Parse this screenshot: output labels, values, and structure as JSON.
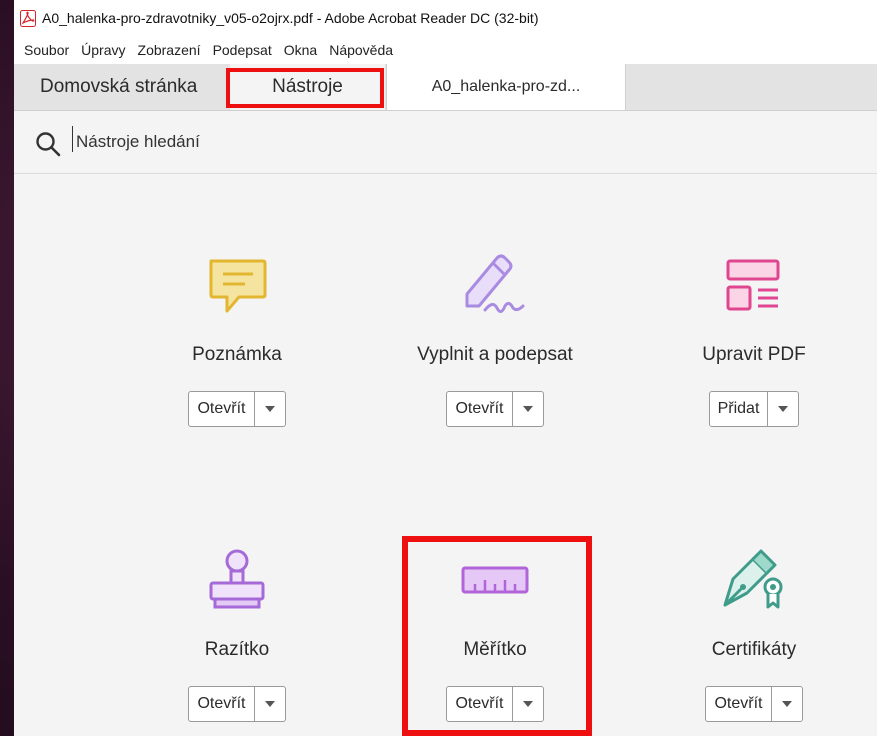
{
  "window": {
    "title": "A0_halenka-pro-zdravotniky_v05-o2ojrx.pdf - Adobe Acrobat Reader DC (32-bit)"
  },
  "menu": [
    "Soubor",
    "Úpravy",
    "Zobrazení",
    "Podepsat",
    "Okna",
    "Nápověda"
  ],
  "tabs": {
    "home": "Domovská stránka",
    "tools": "Nástroje",
    "document": "A0_halenka-pro-zd..."
  },
  "search": {
    "placeholder": "Nástroje hledání"
  },
  "tools": [
    {
      "name": "Poznámka",
      "action": "Otevřít",
      "icon": "comment-icon",
      "color": "#e8c34a"
    },
    {
      "name": "Vyplnit a podepsat",
      "action": "Otevřít",
      "icon": "fill-sign-icon",
      "color": "#a98be2"
    },
    {
      "name": "Upravit PDF",
      "action": "Přidat",
      "icon": "edit-pdf-icon",
      "color": "#e0458f"
    },
    {
      "name": "Razítko",
      "action": "Otevřít",
      "icon": "stamp-icon",
      "color": "#a56ad8"
    },
    {
      "name": "Měřítko",
      "action": "Otevřít",
      "icon": "ruler-icon",
      "color": "#b264d9"
    },
    {
      "name": "Certifikáty",
      "action": "Otevřít",
      "icon": "certificate-icon",
      "color": "#3f9c8a"
    }
  ],
  "colors": {
    "highlight": "#ee1010",
    "background": "#f4f4f4"
  }
}
